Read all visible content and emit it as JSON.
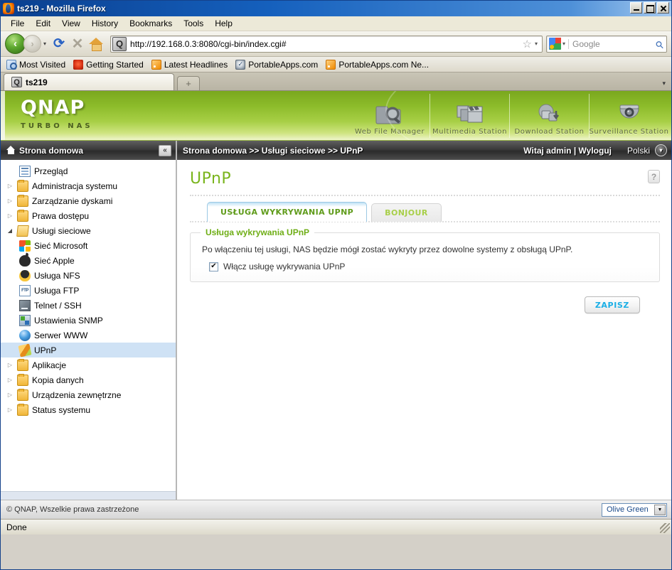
{
  "window": {
    "title": "ts219 - Mozilla Firefox",
    "app_icon": "firefox-icon",
    "minimize_label": "_",
    "maximize_label": "□",
    "close_label": "×"
  },
  "menubar": {
    "items": [
      "File",
      "Edit",
      "View",
      "History",
      "Bookmarks",
      "Tools",
      "Help"
    ]
  },
  "toolbar": {
    "back_glyph": "‹",
    "forward_glyph": "›",
    "history_caret": "▾",
    "reload_glyph": "⟳",
    "stop_glyph": "✕",
    "home_name": "home-icon",
    "url": "http://192.168.0.3:8080/cgi-bin/index.cgi#",
    "star_glyph": "☆",
    "url_caret": "▾",
    "search_placeholder": "Google",
    "search_engine_caret": "▾",
    "search_glyph": "⚲"
  },
  "bookmarks": [
    {
      "label": "Most Visited",
      "icon": "most-visited-icon"
    },
    {
      "label": "Getting Started",
      "icon": "firefox-getting-started-icon"
    },
    {
      "label": "Latest Headlines",
      "icon": "rss-feed-icon"
    },
    {
      "label": "PortableApps.com",
      "icon": "portableapps-icon"
    },
    {
      "label": "PortableApps.com Ne...",
      "icon": "rss-feed-icon"
    }
  ],
  "tabs": {
    "active_tab": "ts219",
    "new_tab_glyph": "+",
    "tab_list_caret": "▾"
  },
  "banner": {
    "logo": "QNAP",
    "tagline": "TURBO NAS",
    "apps": [
      {
        "label": "Web File Manager",
        "icon": "web-file-manager-icon"
      },
      {
        "label": "Multimedia Station",
        "icon": "multimedia-station-icon"
      },
      {
        "label": "Download Station",
        "icon": "download-station-icon"
      },
      {
        "label": "Surveillance Station",
        "icon": "surveillance-station-icon"
      }
    ]
  },
  "navstrip": {
    "home_label": "Strona domowa",
    "home_icon": "home-icon",
    "collapse_glyph": "«",
    "breadcrumb": "Strona domowa >> Usługi sieciowe >> UPnP",
    "user_text": "Witaj admin | Wyloguj",
    "language": "Polski",
    "language_caret": "▾"
  },
  "sidebar": {
    "items": [
      {
        "label": "Przegląd",
        "icon": "overview-icon",
        "arrow": "",
        "indent": 0,
        "selected": false
      },
      {
        "label": "Administracja systemu",
        "icon": "folder-icon",
        "arrow": "▷",
        "indent": 0,
        "selected": false
      },
      {
        "label": "Zarządzanie dyskami",
        "icon": "folder-icon",
        "arrow": "▷",
        "indent": 0,
        "selected": false
      },
      {
        "label": "Prawa dostępu",
        "icon": "folder-icon",
        "arrow": "▷",
        "indent": 0,
        "selected": false
      },
      {
        "label": "Usługi sieciowe",
        "icon": "folder-open-icon",
        "arrow": "◢",
        "indent": 0,
        "selected": false
      },
      {
        "label": "Sieć Microsoft",
        "icon": "microsoft-network-icon",
        "arrow": "",
        "indent": 1,
        "selected": false
      },
      {
        "label": "Sieć Apple",
        "icon": "apple-network-icon",
        "arrow": "",
        "indent": 1,
        "selected": false
      },
      {
        "label": "Usługa NFS",
        "icon": "nfs-penguin-icon",
        "arrow": "",
        "indent": 1,
        "selected": false
      },
      {
        "label": "Usługa FTP",
        "icon": "ftp-icon",
        "arrow": "",
        "indent": 1,
        "selected": false
      },
      {
        "label": "Telnet / SSH",
        "icon": "telnet-ssh-icon",
        "arrow": "",
        "indent": 1,
        "selected": false
      },
      {
        "label": "Ustawienia SNMP",
        "icon": "snmp-icon",
        "arrow": "",
        "indent": 1,
        "selected": false
      },
      {
        "label": "Serwer WWW",
        "icon": "web-server-icon",
        "arrow": "",
        "indent": 1,
        "selected": false
      },
      {
        "label": "UPnP",
        "icon": "upnp-icon",
        "arrow": "",
        "indent": 1,
        "selected": true
      },
      {
        "label": "Aplikacje",
        "icon": "folder-icon",
        "arrow": "▷",
        "indent": 0,
        "selected": false
      },
      {
        "label": "Kopia danych",
        "icon": "folder-icon",
        "arrow": "▷",
        "indent": 0,
        "selected": false
      },
      {
        "label": "Urządzenia zewnętrzne",
        "icon": "folder-icon",
        "arrow": "▷",
        "indent": 0,
        "selected": false
      },
      {
        "label": "Status systemu",
        "icon": "folder-icon",
        "arrow": "▷",
        "indent": 0,
        "selected": false
      }
    ]
  },
  "main": {
    "page_title": "UPnP",
    "help_glyph": "?",
    "tabs": [
      {
        "label": "USŁUGA WYKRYWANIA UPNP",
        "active": true
      },
      {
        "label": "BONJOUR",
        "active": false
      }
    ],
    "fieldset": {
      "legend": "Usługa wykrywania UPnP",
      "description": "Po włączeniu tej usługi, NAS będzie mógł zostać wykryty przez dowolne systemy z obsługą UPnP.",
      "checkbox_label": "Włącz usługę wykrywania UPnP",
      "checkbox_checked": true
    },
    "save_label": "ZAPISZ"
  },
  "qfooter": {
    "copyright": "© QNAP, Wszelkie prawa zastrzeżone",
    "theme_value": "Olive Green",
    "theme_caret": "▼"
  },
  "statusbar": {
    "text": "Done"
  },
  "colors": {
    "brand_green": "#7ab51d",
    "banner_green": "#8cbb2a",
    "accent_blue": "#1aaee5",
    "selection_blue": "#cfe2f5",
    "titlebar_blue": "#1560BD"
  }
}
